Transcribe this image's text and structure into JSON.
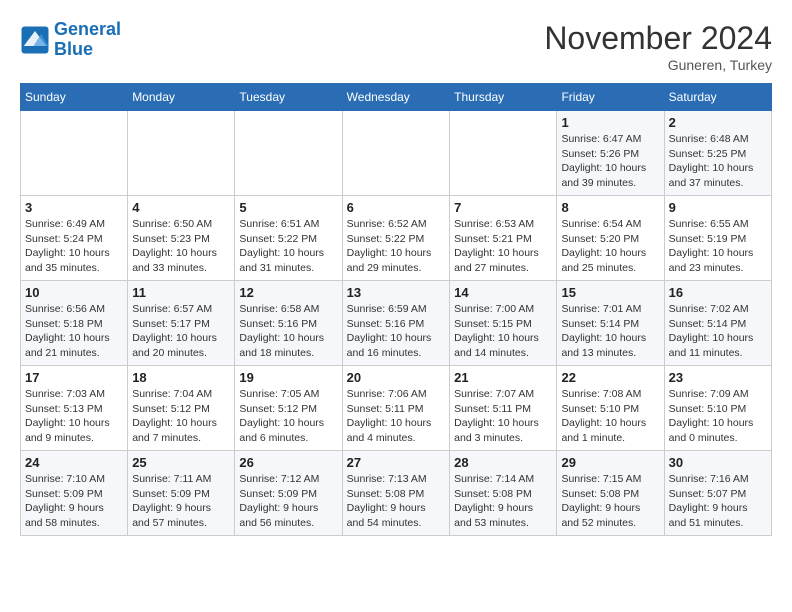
{
  "header": {
    "logo_line1": "General",
    "logo_line2": "Blue",
    "month": "November 2024",
    "location": "Guneren, Turkey"
  },
  "days_of_week": [
    "Sunday",
    "Monday",
    "Tuesday",
    "Wednesday",
    "Thursday",
    "Friday",
    "Saturday"
  ],
  "weeks": [
    [
      {
        "day": "",
        "info": ""
      },
      {
        "day": "",
        "info": ""
      },
      {
        "day": "",
        "info": ""
      },
      {
        "day": "",
        "info": ""
      },
      {
        "day": "",
        "info": ""
      },
      {
        "day": "1",
        "info": "Sunrise: 6:47 AM\nSunset: 5:26 PM\nDaylight: 10 hours and 39 minutes."
      },
      {
        "day": "2",
        "info": "Sunrise: 6:48 AM\nSunset: 5:25 PM\nDaylight: 10 hours and 37 minutes."
      }
    ],
    [
      {
        "day": "3",
        "info": "Sunrise: 6:49 AM\nSunset: 5:24 PM\nDaylight: 10 hours and 35 minutes."
      },
      {
        "day": "4",
        "info": "Sunrise: 6:50 AM\nSunset: 5:23 PM\nDaylight: 10 hours and 33 minutes."
      },
      {
        "day": "5",
        "info": "Sunrise: 6:51 AM\nSunset: 5:22 PM\nDaylight: 10 hours and 31 minutes."
      },
      {
        "day": "6",
        "info": "Sunrise: 6:52 AM\nSunset: 5:22 PM\nDaylight: 10 hours and 29 minutes."
      },
      {
        "day": "7",
        "info": "Sunrise: 6:53 AM\nSunset: 5:21 PM\nDaylight: 10 hours and 27 minutes."
      },
      {
        "day": "8",
        "info": "Sunrise: 6:54 AM\nSunset: 5:20 PM\nDaylight: 10 hours and 25 minutes."
      },
      {
        "day": "9",
        "info": "Sunrise: 6:55 AM\nSunset: 5:19 PM\nDaylight: 10 hours and 23 minutes."
      }
    ],
    [
      {
        "day": "10",
        "info": "Sunrise: 6:56 AM\nSunset: 5:18 PM\nDaylight: 10 hours and 21 minutes."
      },
      {
        "day": "11",
        "info": "Sunrise: 6:57 AM\nSunset: 5:17 PM\nDaylight: 10 hours and 20 minutes."
      },
      {
        "day": "12",
        "info": "Sunrise: 6:58 AM\nSunset: 5:16 PM\nDaylight: 10 hours and 18 minutes."
      },
      {
        "day": "13",
        "info": "Sunrise: 6:59 AM\nSunset: 5:16 PM\nDaylight: 10 hours and 16 minutes."
      },
      {
        "day": "14",
        "info": "Sunrise: 7:00 AM\nSunset: 5:15 PM\nDaylight: 10 hours and 14 minutes."
      },
      {
        "day": "15",
        "info": "Sunrise: 7:01 AM\nSunset: 5:14 PM\nDaylight: 10 hours and 13 minutes."
      },
      {
        "day": "16",
        "info": "Sunrise: 7:02 AM\nSunset: 5:14 PM\nDaylight: 10 hours and 11 minutes."
      }
    ],
    [
      {
        "day": "17",
        "info": "Sunrise: 7:03 AM\nSunset: 5:13 PM\nDaylight: 10 hours and 9 minutes."
      },
      {
        "day": "18",
        "info": "Sunrise: 7:04 AM\nSunset: 5:12 PM\nDaylight: 10 hours and 7 minutes."
      },
      {
        "day": "19",
        "info": "Sunrise: 7:05 AM\nSunset: 5:12 PM\nDaylight: 10 hours and 6 minutes."
      },
      {
        "day": "20",
        "info": "Sunrise: 7:06 AM\nSunset: 5:11 PM\nDaylight: 10 hours and 4 minutes."
      },
      {
        "day": "21",
        "info": "Sunrise: 7:07 AM\nSunset: 5:11 PM\nDaylight: 10 hours and 3 minutes."
      },
      {
        "day": "22",
        "info": "Sunrise: 7:08 AM\nSunset: 5:10 PM\nDaylight: 10 hours and 1 minute."
      },
      {
        "day": "23",
        "info": "Sunrise: 7:09 AM\nSunset: 5:10 PM\nDaylight: 10 hours and 0 minutes."
      }
    ],
    [
      {
        "day": "24",
        "info": "Sunrise: 7:10 AM\nSunset: 5:09 PM\nDaylight: 9 hours and 58 minutes."
      },
      {
        "day": "25",
        "info": "Sunrise: 7:11 AM\nSunset: 5:09 PM\nDaylight: 9 hours and 57 minutes."
      },
      {
        "day": "26",
        "info": "Sunrise: 7:12 AM\nSunset: 5:09 PM\nDaylight: 9 hours and 56 minutes."
      },
      {
        "day": "27",
        "info": "Sunrise: 7:13 AM\nSunset: 5:08 PM\nDaylight: 9 hours and 54 minutes."
      },
      {
        "day": "28",
        "info": "Sunrise: 7:14 AM\nSunset: 5:08 PM\nDaylight: 9 hours and 53 minutes."
      },
      {
        "day": "29",
        "info": "Sunrise: 7:15 AM\nSunset: 5:08 PM\nDaylight: 9 hours and 52 minutes."
      },
      {
        "day": "30",
        "info": "Sunrise: 7:16 AM\nSunset: 5:07 PM\nDaylight: 9 hours and 51 minutes."
      }
    ]
  ]
}
